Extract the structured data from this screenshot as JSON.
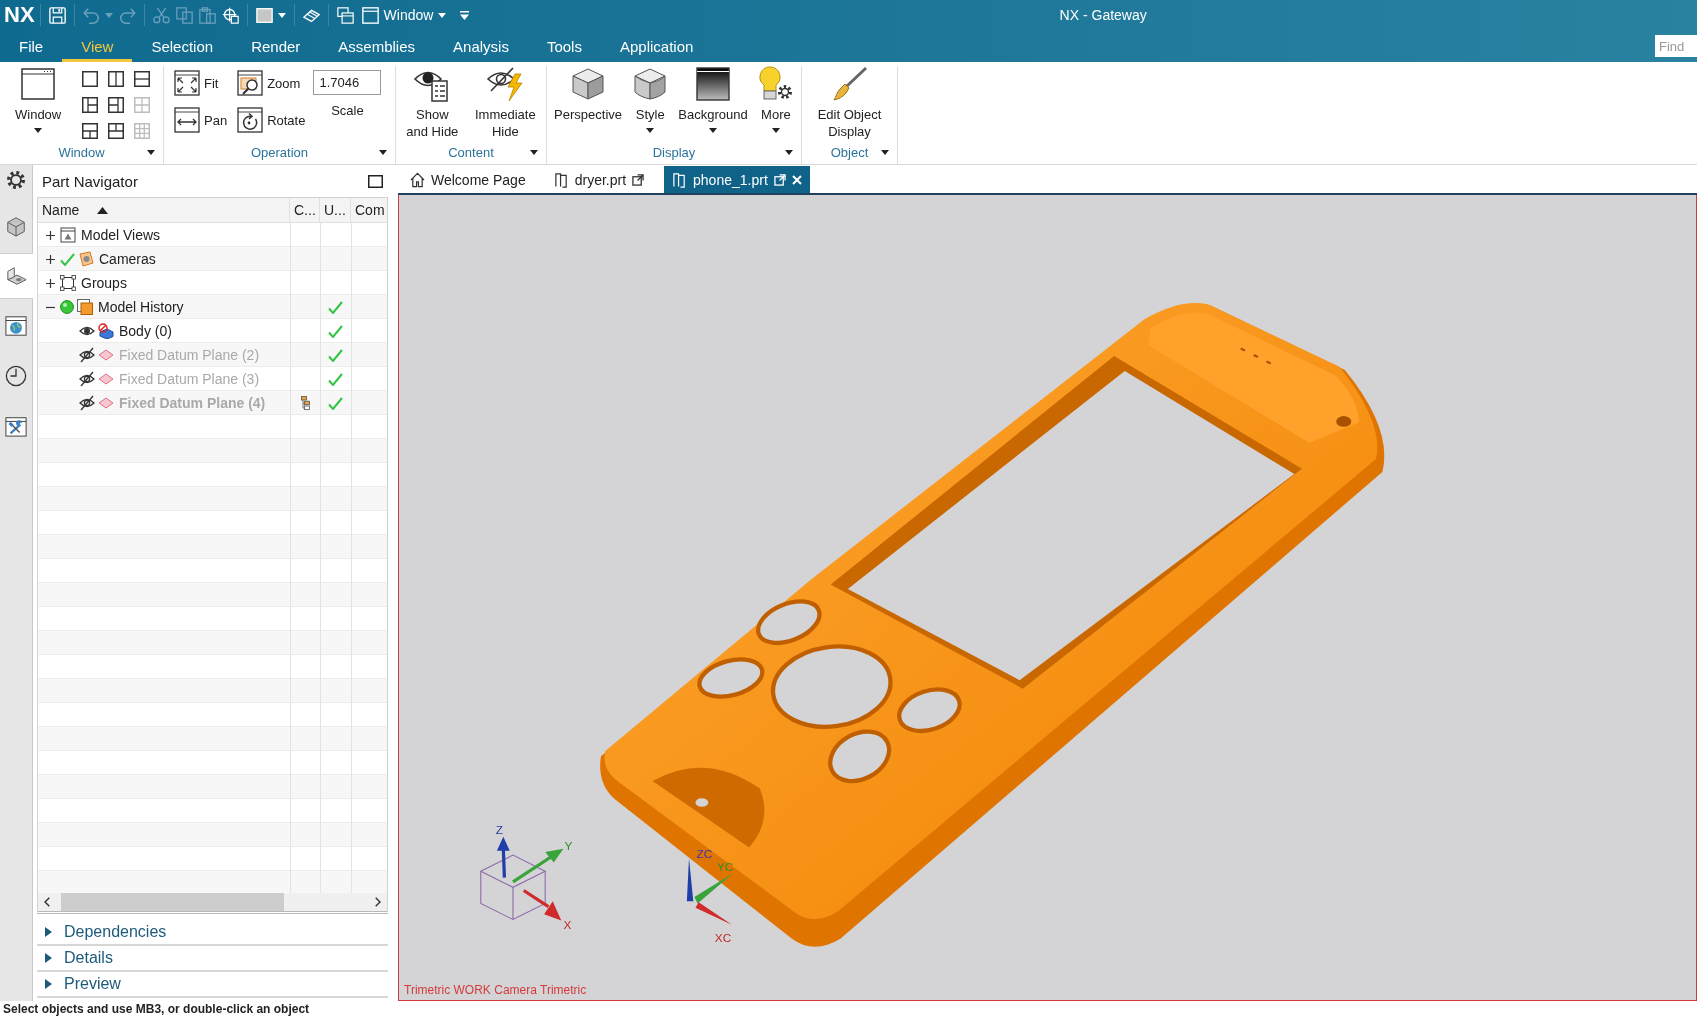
{
  "window": {
    "logo": "NX",
    "title": "NX - Gateway"
  },
  "quick_access": {
    "groups": [
      [
        {
          "kind": "save",
          "disabled": false,
          "dropdown": false
        }
      ],
      [
        {
          "kind": "undo",
          "disabled": true,
          "dropdown": true
        },
        {
          "kind": "redo",
          "disabled": true,
          "dropdown": false
        }
      ],
      [
        {
          "kind": "cut",
          "disabled": true,
          "dropdown": false
        },
        {
          "kind": "copy",
          "disabled": true,
          "dropdown": false
        },
        {
          "kind": "paste",
          "disabled": true,
          "dropdown": false
        },
        {
          "kind": "snap",
          "disabled": false,
          "dropdown": false
        }
      ],
      [
        {
          "kind": "color",
          "disabled": false,
          "dropdown": true
        }
      ],
      [
        {
          "kind": "eraser",
          "disabled": false,
          "dropdown": false
        }
      ],
      [
        {
          "kind": "windows",
          "disabled": false,
          "dropdown": false
        }
      ]
    ],
    "window_menu": {
      "label": "Window"
    }
  },
  "menu_tabs": [
    {
      "label": "File",
      "selected": false
    },
    {
      "label": "View",
      "selected": true
    },
    {
      "label": "Selection",
      "selected": false
    },
    {
      "label": "Render",
      "selected": false
    },
    {
      "label": "Assemblies",
      "selected": false
    },
    {
      "label": "Analysis",
      "selected": false
    },
    {
      "label": "Tools",
      "selected": false
    },
    {
      "label": "Application",
      "selected": false
    }
  ],
  "find": {
    "placeholder": "Find"
  },
  "ribbon": {
    "groups": [
      {
        "label": "Window",
        "buttons": [
          {
            "kind": "window",
            "label": "Window",
            "dropdown": true
          }
        ],
        "layouts": [
          {
            "disabled": false
          },
          {
            "disabled": false
          },
          {
            "disabled": false
          },
          {
            "disabled": false
          },
          {
            "disabled": false
          },
          {
            "disabled": true
          },
          {
            "disabled": false
          },
          {
            "disabled": false
          },
          {
            "disabled": true
          }
        ]
      },
      {
        "label": "Operation",
        "tools": [
          {
            "kind": "fit",
            "label": "Fit"
          },
          {
            "kind": "pan",
            "label": "Pan"
          },
          {
            "kind": "zoom",
            "label": "Zoom"
          },
          {
            "kind": "rotate",
            "label": "Rotate"
          }
        ],
        "scale": {
          "value": "1.7046",
          "label": "Scale"
        }
      },
      {
        "label": "Content",
        "buttons": [
          {
            "kind": "show_hide",
            "label": "Show\nand Hide",
            "dropdown": false
          },
          {
            "kind": "immediate_hide",
            "label": "Immediate\nHide",
            "dropdown": false
          }
        ]
      },
      {
        "label": "Display",
        "buttons": [
          {
            "kind": "perspective",
            "label": "Perspective",
            "dropdown": false
          },
          {
            "kind": "style",
            "label": "Style",
            "dropdown": true
          },
          {
            "kind": "background",
            "label": "Background",
            "dropdown": true
          },
          {
            "kind": "more",
            "label": "More",
            "dropdown": true
          }
        ]
      },
      {
        "label": "Object",
        "buttons": [
          {
            "kind": "edit_display",
            "label": "Edit Object\nDisplay",
            "dropdown": false
          }
        ]
      }
    ]
  },
  "side_tabs": [
    {
      "kind": "assembly",
      "selected": false
    },
    {
      "kind": "part",
      "selected": true
    },
    {
      "kind": "web",
      "selected": false
    },
    {
      "kind": "history",
      "selected": false
    },
    {
      "kind": "reuse",
      "selected": false
    }
  ],
  "navigator": {
    "title": "Part Navigator",
    "columns": [
      {
        "label": "Name",
        "sorted": true
      },
      {
        "label": "C...",
        "sorted": false
      },
      {
        "label": "U...",
        "sorted": false
      },
      {
        "label": "Com",
        "sorted": false
      }
    ],
    "rows": [
      {
        "label": "Model Views",
        "kind": "views",
        "expanded": false,
        "checked": false,
        "active": false,
        "u_check": false
      },
      {
        "label": "Cameras",
        "kind": "cameras",
        "expanded": false,
        "checked": true,
        "active": false,
        "u_check": false
      },
      {
        "label": "Groups",
        "kind": "groups",
        "expanded": false,
        "checked": false,
        "active": false,
        "u_check": false
      },
      {
        "label": "Model History",
        "kind": "history",
        "expanded": true,
        "checked": false,
        "active": true,
        "u_check": true,
        "children": [
          {
            "label": "Body (0)",
            "kind": "body",
            "visible": true,
            "current": false,
            "c_icon": false,
            "u_check": true
          },
          {
            "label": "Fixed Datum Plane (2)",
            "kind": "datum",
            "visible": false,
            "current": false,
            "c_icon": false,
            "u_check": true
          },
          {
            "label": "Fixed Datum Plane (3)",
            "kind": "datum",
            "visible": false,
            "current": false,
            "c_icon": false,
            "u_check": true
          },
          {
            "label": "Fixed Datum Plane (4)",
            "kind": "datum",
            "visible": false,
            "current": true,
            "c_icon": true,
            "u_check": true
          }
        ]
      }
    ],
    "sections": [
      {
        "label": "Dependencies",
        "expanded": false
      },
      {
        "label": "Details",
        "expanded": false
      },
      {
        "label": "Preview",
        "expanded": false
      }
    ]
  },
  "doc_tabs": [
    {
      "kind": "home",
      "label": "Welcome Page",
      "selected": false,
      "popout": false,
      "closable": false
    },
    {
      "kind": "part",
      "label": "dryer.prt",
      "selected": false,
      "popout": true,
      "closable": false
    },
    {
      "kind": "part",
      "label": "phone_1.prt",
      "selected": true,
      "popout": true,
      "closable": true
    }
  ],
  "viewport": {
    "caption": "Trimetric WORK Camera Trimetric",
    "view_triad": {
      "x": "X",
      "y": "Y",
      "z": "Z"
    },
    "wcs_triad": {
      "x": "XC",
      "y": "YC",
      "z": "ZC"
    }
  },
  "status_bar": {
    "text": "Select objects and use MB3, or double-click an object"
  }
}
